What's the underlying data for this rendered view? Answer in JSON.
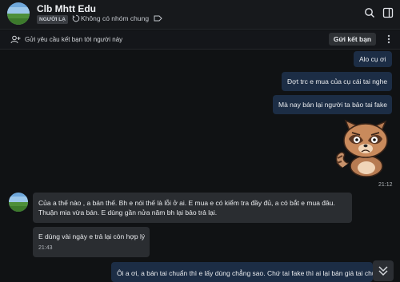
{
  "colors": {
    "background": "#101214",
    "outgoing_bubble": "#1c2d45",
    "incoming_bubble": "#2a2d31",
    "accent": "#0068ff"
  },
  "header": {
    "title": "Clb Mhtt Edu",
    "badge": "NGƯỜI LẠ",
    "group_text": "Không có nhóm chung",
    "icons": [
      "group-icon",
      "tag-icon",
      "search-icon",
      "layout-icon"
    ]
  },
  "request_bar": {
    "text": "Gửi yêu cầu kết bạn tới người này",
    "button": "Gửi kết bạn",
    "icons": [
      "add-user-icon",
      "more-icon"
    ]
  },
  "messages": {
    "out_1": "Alo cụ ơi",
    "out_2": "Đợt trc e mua của cụ cái tai nghe",
    "out_3": "Mà nay bán lại người ta bảo tai fake",
    "sticker_time": "21:12",
    "in_1_line1": "Của a thế nào , a bán thế. Bh e nói thế là lỗi ở ai. E mua e có kiểm tra đầy đủ, a có bắt e mua đâu.",
    "in_1_line2": "Thuận mia vừa bán. E dùng gần nửa năm bh lại bảo trả lại.",
    "in_2": "E dùng vài ngày e trả lại còn hợp lý",
    "in_2_time": "21:43",
    "out_4": "Ôi a ơi, a bán tai chuẩn thì e lấy dùng chẳng sao. Chứ tai fake thì ai lại bán giá tai chuẩn"
  }
}
